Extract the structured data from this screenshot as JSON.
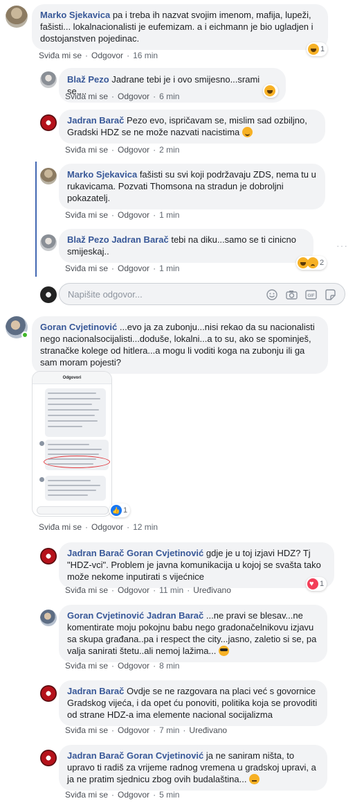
{
  "actions": {
    "like": "Sviđa mi se",
    "reply": "Odgovor",
    "edited": "Uređivano"
  },
  "comments": [
    {
      "author": "Marko Sjekavica",
      "text": "pa i treba ih nazvat svojim imenom, mafija, lupeži, fašisti... lokalnacionalisti je eufemizam. a i eichmann je bio ugladjen i dostojanstven pojedinac.",
      "time": "16 min",
      "reaction_count": "1",
      "reactions": [
        "haha-icon"
      ]
    },
    {
      "author": "Blaž Pezo",
      "text": "Jadrane tebi je i ovo smijesno...srami se....",
      "time": "6 min",
      "reactions": [
        "haha-icon"
      ]
    },
    {
      "author": "Jadran Barač",
      "text": "Pezo evo, ispričavam se, mislim sad ozbiljno, Gradski HDZ se ne može nazvati nacistima",
      "time": "2 min"
    },
    {
      "author": "Marko Sjekavica",
      "text": "fašisti su svi koji podržavaju ZDS, nema tu u rukavicama. Pozvati Thomsona na stradun je dobroljni pokazatelj.",
      "time": "1 min"
    },
    {
      "author": "Blaž Pezo",
      "mention": "Jadran Barač",
      "text": "tebi na diku...samo se ti cinicno smijeskaj..",
      "time": "1 min",
      "reaction_count": "2",
      "reactions": [
        "haha-icon",
        "sad-icon"
      ]
    }
  ],
  "reply_box": {
    "placeholder": "Napišite odgovor..."
  },
  "main_comment": {
    "author": "Goran Cvjetinović",
    "text": "...evo ja za zubonju...nisi rekao da su nacionalisti nego nacionalsocijalisti...doduše, lokalni...a to su, ako se spominješ, stranačke kolege od hitlera...a mogu li voditi koga na zubonju ili ga sam moram pojesti?",
    "time": "12 min",
    "reaction_count": "1",
    "attachment": {
      "header": "Odgovori"
    }
  },
  "replies": [
    {
      "author": "Jadran Barač",
      "mention": "Goran Cvjetinović",
      "text": "gdje je u toj izjavi HDZ? Tj \"HDZ-vci\". Problem je javna komunikacija u kojoj se svašta tako može nekome inputirati s vijećnice",
      "time": "11 min",
      "reaction_count": "1"
    },
    {
      "author": "Goran Cvjetinović",
      "mention": "Jadran Barač",
      "text": "...ne pravi se blesav...ne komentirate moju pokojnu babu nego gradonačelnikovu izjavu sa skupa građana..pa i respect the city...jasno, zaletio si se, pa valja sanirati štetu..ali nemoj lažima...",
      "time": "8 min"
    },
    {
      "author": "Jadran Barač",
      "text": "Ovdje se ne razgovara na placi već s govornice Gradskog vijeća, i da opet ću ponoviti, politika koja se provoditi od strane HDZ-a ima elemente nacional socijalizma",
      "time": "7 min"
    },
    {
      "author": "Jadran Barač",
      "mention": "Goran Cvjetinović",
      "text": "ja ne saniram ništa, to upravo ti radiš za vrijeme radnog vremena u gradskoj upravi, a ja ne pratim sjednicu zbog ovih budalaština...",
      "time": "5 min"
    }
  ]
}
